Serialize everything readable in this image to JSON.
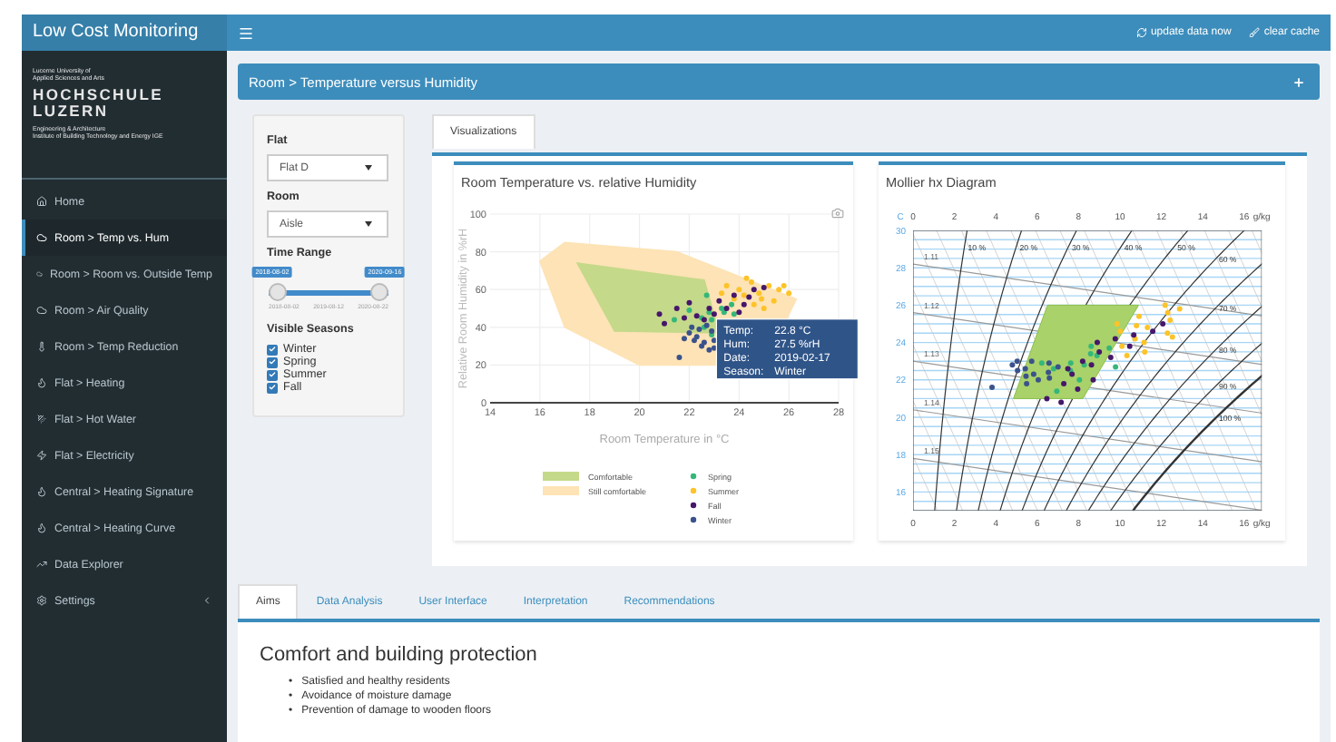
{
  "header": {
    "title": "Low Cost Monitoring",
    "actions": [
      {
        "kind": "refresh",
        "label": "update data now"
      },
      {
        "kind": "brush",
        "label": "clear cache"
      }
    ]
  },
  "sidebar": {
    "brand": {
      "university_lines": [
        "Lucerne University of",
        "Applied Sciences and Arts"
      ],
      "name_lines": [
        "HOCHSCHULE",
        "LUZERN"
      ],
      "department_lines": [
        "Engineering & Architecture",
        "Institute of Building Technology and Energy IGE"
      ]
    },
    "items": [
      {
        "label": "Home",
        "kind": "home",
        "selected": false
      },
      {
        "label": "Room > Temp vs. Hum",
        "kind": "room",
        "selected": true
      },
      {
        "label": "Room > Room vs. Outside Temp",
        "kind": "room",
        "selected": false
      },
      {
        "label": "Room > Air Quality",
        "kind": "room",
        "selected": false
      },
      {
        "label": "Room > Temp Reduction",
        "kind": "thermometer",
        "selected": false
      },
      {
        "label": "Flat > Heating",
        "kind": "heating",
        "selected": false
      },
      {
        "label": "Flat > Hot Water",
        "kind": "water",
        "selected": false
      },
      {
        "label": "Flat > Electricity",
        "kind": "electricity",
        "selected": false
      },
      {
        "label": "Central > Heating Signature",
        "kind": "heating",
        "selected": false
      },
      {
        "label": "Central > Heating Curve",
        "kind": "heating",
        "selected": false
      },
      {
        "label": "Data Explorer",
        "kind": "chart",
        "selected": false
      },
      {
        "label": "Settings",
        "kind": "settings",
        "selected": false,
        "expanded": false
      }
    ]
  },
  "breadcrumb": {
    "title": "Room > Temperature versus Humidity"
  },
  "controls": {
    "selects": [
      {
        "label": "Flat",
        "value": "Flat D"
      },
      {
        "label": "Room",
        "value": "Aisle"
      }
    ],
    "time_range": {
      "label": "Time Range",
      "thumbs": [
        {
          "label": "2018-08-02",
          "level": 0
        },
        {
          "label": "2020-09-16",
          "level": 1
        }
      ],
      "ticks": [
        "2018-08-02",
        "2019-08-12",
        "2020-08-22"
      ]
    },
    "seasons": {
      "label": "Visible Seasons",
      "options": [
        {
          "label": "Winter",
          "checked": true
        },
        {
          "label": "Spring",
          "checked": true
        },
        {
          "label": "Summer",
          "checked": true
        },
        {
          "label": "Fall",
          "checked": true
        }
      ]
    }
  },
  "visualization_tabs": [
    {
      "label": "Visualizations",
      "selected": true
    }
  ],
  "humidity_chart": {
    "chart_data": {
      "type": "scatter",
      "title": "Room Temperature vs. relative Humidity",
      "xlabel": "Room Temperature in °C",
      "ylabel": "Relative Room Humidity in %rH",
      "xlim": [
        14,
        28
      ],
      "ylim": [
        0,
        100
      ],
      "xticks": [
        14,
        16,
        18,
        20,
        22,
        24,
        26,
        28
      ],
      "yticks": [
        0,
        20,
        40,
        60,
        80,
        100
      ],
      "series": [
        {
          "name": "Spring",
          "color": "#35b779",
          "x": [
            22.6,
            22.9,
            22.0,
            23.7,
            21.4,
            22.8,
            22.7,
            23.3,
            22.5,
            23.8,
            22.9,
            23.4
          ],
          "values": [
            40,
            44,
            49,
            52,
            44,
            48,
            57,
            50,
            45,
            47,
            36,
            48
          ]
        },
        {
          "name": "Summer",
          "color": "#fdc328",
          "x": [
            23.5,
            24.0,
            24.5,
            24.8,
            25.2,
            25.6,
            23.8,
            24.3,
            24.9,
            25.0,
            26.0,
            24.6,
            23.3,
            25.4,
            24.2,
            25.8
          ],
          "values": [
            62,
            60,
            64,
            58,
            62,
            60,
            55,
            66,
            55,
            50,
            58,
            52,
            58,
            54,
            57,
            62
          ]
        },
        {
          "name": "Fall",
          "color": "#46176a",
          "x": [
            20.8,
            21.0,
            21.5,
            22.0,
            22.3,
            22.8,
            23.2,
            23.8,
            24.2,
            24.6,
            25.0,
            24.0,
            22.6,
            21.8,
            23.5,
            24.4,
            23.0
          ],
          "values": [
            47,
            42,
            50,
            53,
            46,
            50,
            54,
            57,
            52,
            60,
            61,
            48,
            44,
            45,
            50,
            56,
            47
          ]
        },
        {
          "name": "Winter",
          "color": "#3b528b",
          "x": [
            22.3,
            22.6,
            22.8,
            22.9,
            23.0,
            22.2,
            22.5,
            22.0,
            21.6,
            22.1,
            22.7,
            23.0,
            22.4,
            21.8
          ],
          "values": [
            35,
            32,
            28,
            38,
            33,
            33,
            30,
            37,
            24,
            40,
            41,
            29,
            39,
            34
          ]
        }
      ],
      "grid": true,
      "legend": "bottom"
    },
    "zones": [
      {
        "label": "Comfortable",
        "color": "#c5d98a"
      },
      {
        "label": "Still comfortable",
        "color": "#fde3b5"
      }
    ],
    "tooltip": {
      "rows": [
        {
          "label": "Temp:",
          "value": "22.8 °C"
        },
        {
          "label": "Hum:",
          "value": "27.5 %rH"
        },
        {
          "label": "Date:",
          "value": "2019-02-17"
        },
        {
          "label": "Season:",
          "value": "Winter"
        }
      ]
    }
  },
  "mollier_chart": {
    "title": "Mollier hx Diagram",
    "y_unit": "C",
    "x_unit_top": "g/kg",
    "x_unit_bottom": "g/kg",
    "top_ticks": [
      "0",
      "2",
      "4",
      "6",
      "8",
      "10",
      "12",
      "14",
      "16"
    ],
    "bottom_ticks": [
      "0",
      "2",
      "4",
      "6",
      "8",
      "10",
      "12",
      "14",
      "16"
    ],
    "y_ticks": [
      "30",
      "28",
      "26",
      "24",
      "22",
      "20",
      "18",
      "16"
    ],
    "humidity_labels": [
      "10 %",
      "20 %",
      "30 %",
      "40 %",
      "50 %",
      "60 %",
      "70 %",
      "80 %",
      "90 %",
      "100 %"
    ],
    "density_labels": [
      "1.11",
      "1.12",
      "1.13",
      "1.14",
      "1.15"
    ]
  },
  "info_tabs": [
    {
      "label": "Aims",
      "selected": true
    },
    {
      "label": "Data Analysis",
      "selected": false
    },
    {
      "label": "User Interface",
      "selected": false
    },
    {
      "label": "Interpretation",
      "selected": false
    },
    {
      "label": "Recommendations",
      "selected": false
    }
  ],
  "info_content": {
    "heading": "Comfort and building protection",
    "bullets": [
      {
        "marker": "•",
        "text": "Satisfied and healthy residents"
      },
      {
        "marker": "•",
        "text": "Avoidance of moisture damage"
      },
      {
        "marker": "•",
        "text": "Prevention of damage to wooden floors"
      }
    ]
  }
}
